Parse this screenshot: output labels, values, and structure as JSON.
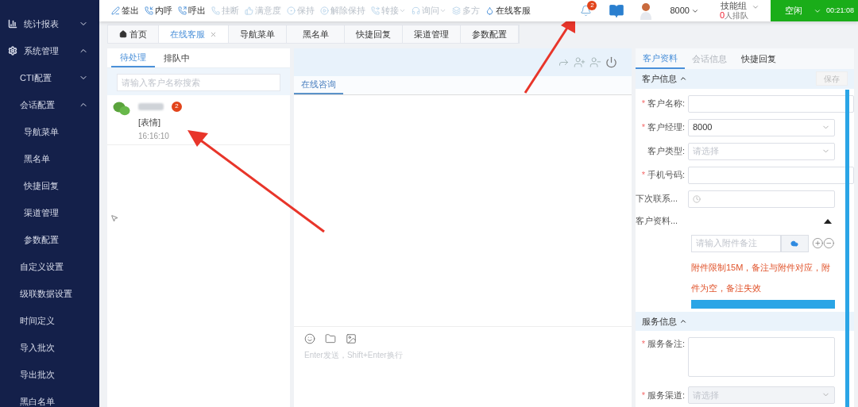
{
  "sidebar": {
    "items": [
      {
        "label": "统计报表",
        "expanded": false
      },
      {
        "label": "系统管理",
        "expanded": true,
        "children": [
          {
            "label": "CTI配置",
            "expanded": false
          },
          {
            "label": "会话配置",
            "expanded": true,
            "children": [
              {
                "label": "导航菜单"
              },
              {
                "label": "黑名单"
              },
              {
                "label": "快捷回复"
              },
              {
                "label": "渠道管理"
              },
              {
                "label": "参数配置"
              }
            ]
          },
          {
            "label": "自定义设置"
          },
          {
            "label": "级联数据设置"
          },
          {
            "label": "时间定义"
          },
          {
            "label": "导入批次"
          },
          {
            "label": "导出批次"
          },
          {
            "label": "黑白名单"
          }
        ]
      }
    ]
  },
  "toolbar": {
    "actions": [
      {
        "label": "签出",
        "disabled": false,
        "has_menu": false
      },
      {
        "label": "内呼",
        "disabled": false,
        "has_menu": false
      },
      {
        "label": "呼出",
        "disabled": false,
        "has_menu": false
      },
      {
        "label": "挂断",
        "disabled": true,
        "has_menu": false
      },
      {
        "label": "满意度",
        "disabled": true,
        "has_menu": false
      },
      {
        "label": "保持",
        "disabled": true,
        "has_menu": false
      },
      {
        "label": "解除保持",
        "disabled": true,
        "has_menu": false
      },
      {
        "label": "转接",
        "disabled": true,
        "has_menu": true
      },
      {
        "label": "询问",
        "disabled": true,
        "has_menu": true
      },
      {
        "label": "多方",
        "disabled": true,
        "has_menu": false
      },
      {
        "label": "在线客服",
        "disabled": false,
        "has_menu": false
      }
    ],
    "notification_count": "2",
    "agent": "8000",
    "skill_group": "技能组",
    "queue_count": "0",
    "queue_label": "人排队",
    "status": "空闲",
    "timer": "00:21:08"
  },
  "tabs": [
    {
      "label": "首页",
      "selected": false,
      "closable": false
    },
    {
      "label": "在线客服",
      "selected": true,
      "closable": true
    },
    {
      "label": "导航菜单",
      "selected": false,
      "closable": false
    },
    {
      "label": "黑名单",
      "selected": false,
      "closable": false
    },
    {
      "label": "快捷回复",
      "selected": false,
      "closable": false
    },
    {
      "label": "渠道管理",
      "selected": false,
      "closable": false
    },
    {
      "label": "参数配置",
      "selected": false,
      "closable": false
    }
  ],
  "session_list": {
    "tabs": [
      {
        "label": "待处理",
        "selected": true
      },
      {
        "label": "排队中",
        "selected": false
      }
    ],
    "search": {
      "placeholder": "请输入客户名称搜索"
    },
    "sessions": [
      {
        "unread": "2",
        "message": "[表情]",
        "time": "16:16:10",
        "selected": false
      }
    ]
  },
  "chat": {
    "tabs": [
      {
        "label": "在线咨询",
        "selected": true
      }
    ],
    "input": {
      "placeholder": "Enter发送，Shift+Enter换行"
    }
  },
  "details": {
    "tabs": [
      {
        "label": "客户资料",
        "selected": true,
        "disabled": false
      },
      {
        "label": "会话信息",
        "selected": false,
        "disabled": true
      },
      {
        "label": "快捷回复",
        "selected": false,
        "disabled": false
      }
    ],
    "customer_section": {
      "title": "客户信息",
      "expanded": true,
      "save_button": {
        "label": "保存",
        "disabled": true
      },
      "fields": [
        {
          "kind": "text",
          "label": "客户名称:",
          "required_mark": "*"
        },
        {
          "kind": "select",
          "label": "客户经理:",
          "required_mark": "*",
          "value": "8000"
        },
        {
          "kind": "select",
          "label": "客户类型:",
          "placeholder": "请选择"
        },
        {
          "kind": "text",
          "label": "手机号码:",
          "required_mark": "*"
        },
        {
          "kind": "date",
          "label": "下次联系..."
        },
        {
          "kind": "attachment",
          "label": "客户资料...",
          "expanded": true,
          "placeholder": "请输入附件备注",
          "note": "附件限制15M，备注与附件对应，附件为空，备注失效"
        }
      ]
    },
    "service_section": {
      "title": "服务信息",
      "expanded": true,
      "fields": [
        {
          "kind": "textarea",
          "label": "服务备注:",
          "required_mark": "*"
        },
        {
          "kind": "select",
          "label": "服务渠道:",
          "required_mark": "*",
          "placeholder": "请选择",
          "disabled": true
        }
      ]
    }
  }
}
